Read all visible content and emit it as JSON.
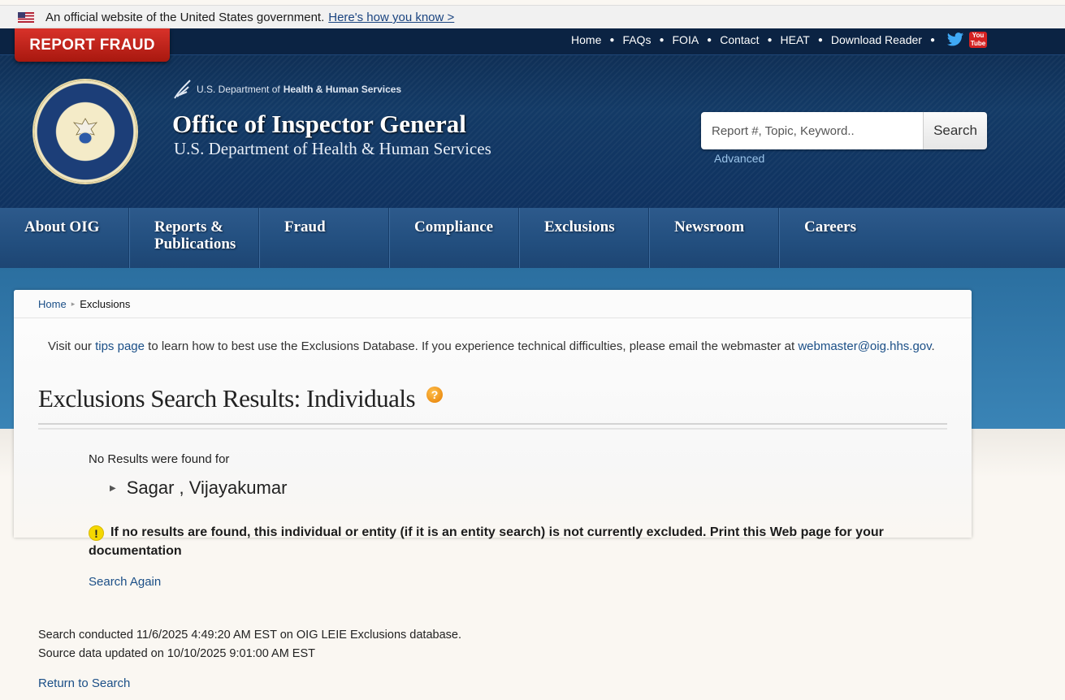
{
  "gov_banner": {
    "text": "An official website of the United States government.",
    "link": "Here's how you know >"
  },
  "header": {
    "report_fraud": "REPORT FRAUD",
    "util_nav": [
      "Home",
      "FAQs",
      "FOIA",
      "Contact",
      "HEAT",
      "Download Reader"
    ],
    "hhs_prefix": "U.S. Department of",
    "hhs_bold": "Health & Human Services",
    "title": "Office of Inspector General",
    "subtitle": "U.S. Department of Health & Human Services",
    "search_placeholder": "Report #, Topic, Keyword..",
    "search_button": "Search",
    "advanced": "Advanced",
    "youtube_label": "You Tube"
  },
  "main_nav": [
    "About OIG",
    "Reports & Publications",
    "Fraud",
    "Compliance",
    "Exclusions",
    "Newsroom",
    "Careers"
  ],
  "breadcrumb": {
    "home": "Home",
    "current": "Exclusions"
  },
  "tip": {
    "before": "Visit our ",
    "link": "tips page",
    "middle": " to learn how to best use the Exclusions Database. If you experience technical difficulties, please email the webmaster at ",
    "email": "webmaster@oig.hhs.gov",
    "after": "."
  },
  "results": {
    "title": "Exclusions Search Results: Individuals",
    "no_results": "No Results were found for",
    "name": "Sagar , Vijayakumar",
    "warning": "If no results are found, this individual or entity (if it is an entity search) is not currently excluded. Print this Web page for your documentation",
    "search_again": "Search Again"
  },
  "meta": {
    "conducted": "Search conducted 11/6/2025 4:49:20 AM EST on OIG LEIE Exclusions database.",
    "updated": "Source data updated on 10/10/2025 9:01:00 AM EST",
    "return": "Return to Search"
  },
  "colors": {
    "header_dark": "#0d2a4e",
    "report_red": "#c0241b",
    "link_blue": "#1b4f87",
    "warning_yellow": "#f5d800"
  }
}
